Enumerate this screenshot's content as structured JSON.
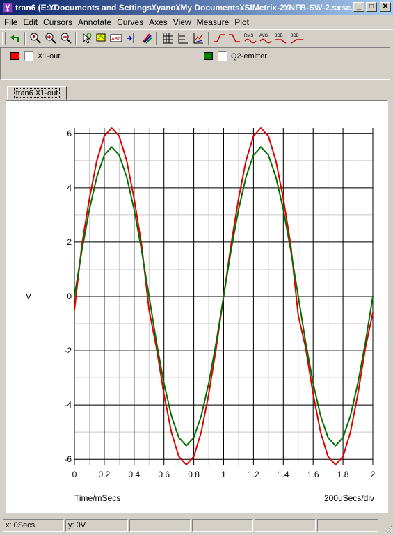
{
  "window": {
    "title": "tran6 (E:¥Documents and Settings¥yano¥My Documents¥SIMetrix-2¥NFB-SW-2.sxsc...",
    "app_icon_glyph": "Ɣ",
    "minimize_glyph": "_",
    "maximize_glyph": "□",
    "close_glyph": "✕"
  },
  "menu": [
    "File",
    "Edit",
    "Cursors",
    "Annotate",
    "Curves",
    "Axes",
    "View",
    "Measure",
    "Plot"
  ],
  "toolbar": {
    "icons": [
      "undo-icon",
      "zoom-in-full-icon",
      "zoom-in-icon",
      "zoom-out-icon",
      "cursor-select-icon",
      "move-curve-icon",
      "label-icon",
      "add-axis-icon",
      "curve-color-icon",
      "grid-lines-icon",
      "axis-grid-icon",
      "stacked-plot-icon",
      "rise-time-icon",
      "fall-time-icon",
      "rms-icon",
      "avg-icon",
      "3db-low-icon",
      "3db-high-icon"
    ],
    "rms_label": "RMS",
    "avg_label": "AVG",
    "db_label_1": "3DB",
    "db_label_2": "3DB"
  },
  "legend": [
    {
      "name": "X1-out",
      "color": "#ff0000",
      "checked": false
    },
    {
      "name": "Q2-emitter",
      "color": "#008000",
      "checked": false
    }
  ],
  "tab": {
    "label": "tran6 X1-out"
  },
  "chart_data": {
    "type": "line",
    "xlabel": "Time/mSecs",
    "ylabel": "V",
    "x_scale_note": "200uSecs/div",
    "xlim": [
      0,
      2
    ],
    "ylim": [
      -6.2,
      6.2
    ],
    "x_ticks": [
      0,
      0.2,
      0.4,
      0.6,
      0.8,
      1,
      1.2,
      1.4,
      1.6,
      1.8,
      2
    ],
    "y_ticks": [
      -6,
      -4,
      -2,
      0,
      2,
      4,
      6
    ],
    "x_tick_labels": [
      "0",
      "0.2",
      "0.4",
      "0.6",
      "0.8",
      "1",
      "1.2",
      "1.4",
      "1.6",
      "1.8",
      "2"
    ],
    "y_tick_labels": [
      "-6",
      "-4",
      "-2",
      "0",
      "2",
      "4",
      "6"
    ],
    "grid": true,
    "series": [
      {
        "name": "X1-out",
        "color": "#e00000",
        "x": [
          0,
          0.05,
          0.1,
          0.15,
          0.2,
          0.25,
          0.3,
          0.35,
          0.4,
          0.45,
          0.5,
          0.55,
          0.6,
          0.65,
          0.7,
          0.75,
          0.8,
          0.85,
          0.9,
          0.95,
          1.0,
          1.05,
          1.1,
          1.15,
          1.2,
          1.25,
          1.3,
          1.35,
          1.4,
          1.45,
          1.5,
          1.55,
          1.6,
          1.65,
          1.7,
          1.75,
          1.8,
          1.85,
          1.9,
          1.95,
          2.0
        ],
        "y": [
          -0.5,
          1.9,
          3.6,
          5.0,
          5.9,
          6.2,
          5.9,
          5.0,
          3.6,
          1.9,
          -0.5,
          -1.9,
          -3.6,
          -5.0,
          -5.9,
          -6.2,
          -5.9,
          -5.0,
          -3.6,
          -1.9,
          0.0,
          1.9,
          3.6,
          5.0,
          5.9,
          6.2,
          5.9,
          5.0,
          3.6,
          1.9,
          -0.7,
          -1.9,
          -3.6,
          -5.0,
          -5.9,
          -6.2,
          -5.9,
          -5.0,
          -3.6,
          -1.9,
          -0.6
        ]
      },
      {
        "name": "Q2-emitter",
        "color": "#007000",
        "x": [
          0,
          0.05,
          0.1,
          0.15,
          0.2,
          0.25,
          0.3,
          0.35,
          0.4,
          0.45,
          0.5,
          0.55,
          0.6,
          0.65,
          0.7,
          0.75,
          0.8,
          0.85,
          0.9,
          0.95,
          1.0,
          1.05,
          1.1,
          1.15,
          1.2,
          1.25,
          1.3,
          1.35,
          1.4,
          1.45,
          1.5,
          1.55,
          1.6,
          1.65,
          1.7,
          1.75,
          1.8,
          1.85,
          1.9,
          1.95,
          2.0
        ],
        "y": [
          0.0,
          1.7,
          3.2,
          4.4,
          5.2,
          5.5,
          5.2,
          4.4,
          3.2,
          1.7,
          0.0,
          -1.7,
          -3.2,
          -4.4,
          -5.2,
          -5.5,
          -5.2,
          -4.4,
          -3.2,
          -1.7,
          0.0,
          1.7,
          3.2,
          4.4,
          5.2,
          5.5,
          5.2,
          4.4,
          3.2,
          1.7,
          0.0,
          -1.7,
          -3.2,
          -4.4,
          -5.2,
          -5.5,
          -5.2,
          -4.4,
          -3.2,
          -1.7,
          0.0
        ]
      }
    ]
  },
  "status": {
    "x": "x: 0Secs",
    "y": "y: 0V"
  }
}
